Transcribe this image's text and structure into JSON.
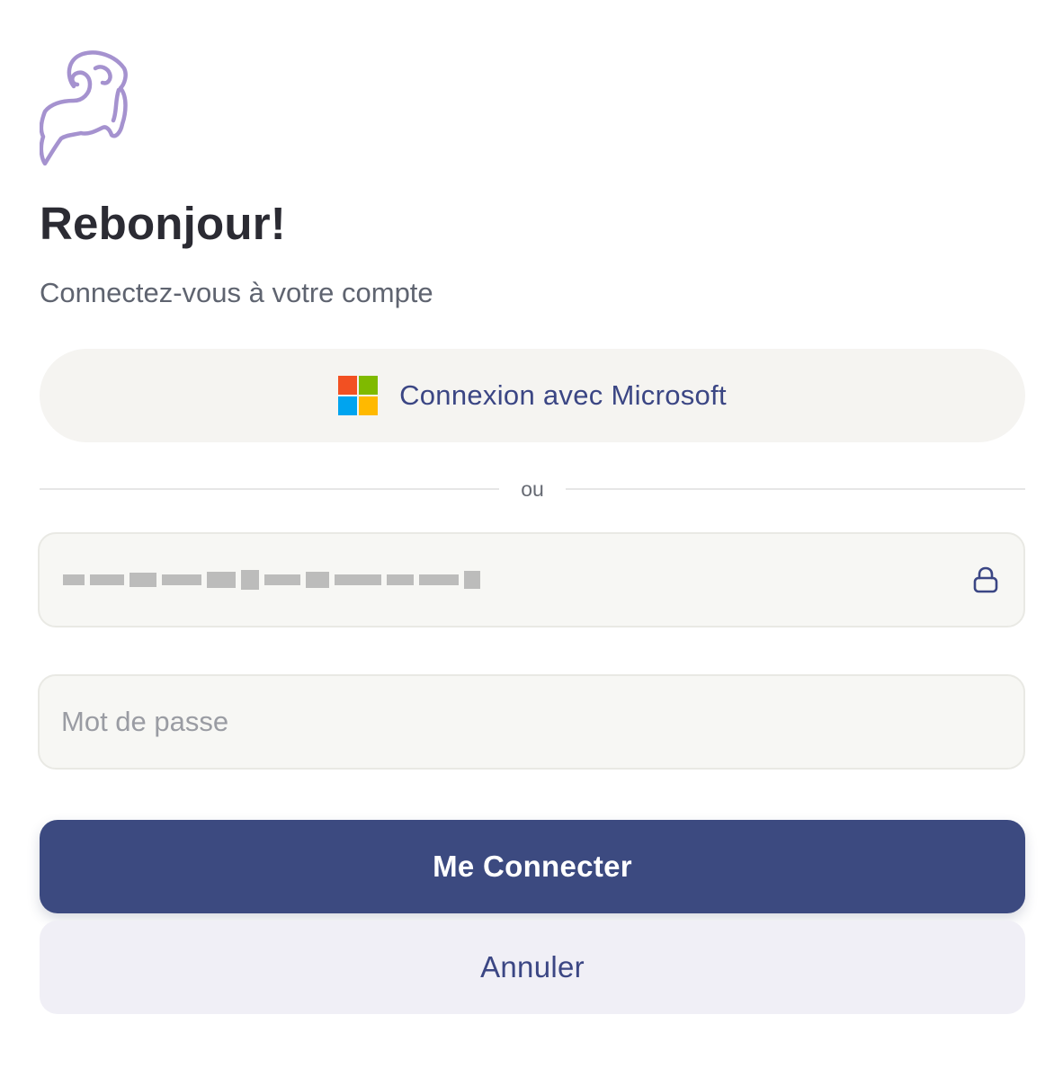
{
  "header": {
    "title": "Rebonjour!",
    "subtitle": "Connectez-vous à votre compte"
  },
  "microsoft_button": {
    "label": "Connexion avec Microsoft",
    "logo_colors": [
      "#f25022",
      "#7fba00",
      "#00a4ef",
      "#ffb900"
    ]
  },
  "divider": {
    "label": "ou"
  },
  "email_field": {
    "value_redacted": true,
    "icon": "lock-icon"
  },
  "password_field": {
    "value": "",
    "placeholder": "Mot de passe"
  },
  "actions": {
    "submit_label": "Me Connecter",
    "cancel_label": "Annuler"
  },
  "colors": {
    "brand_primary": "#3c4a80",
    "brand_text": "#3b4684",
    "logo_stroke": "#a592cf"
  }
}
